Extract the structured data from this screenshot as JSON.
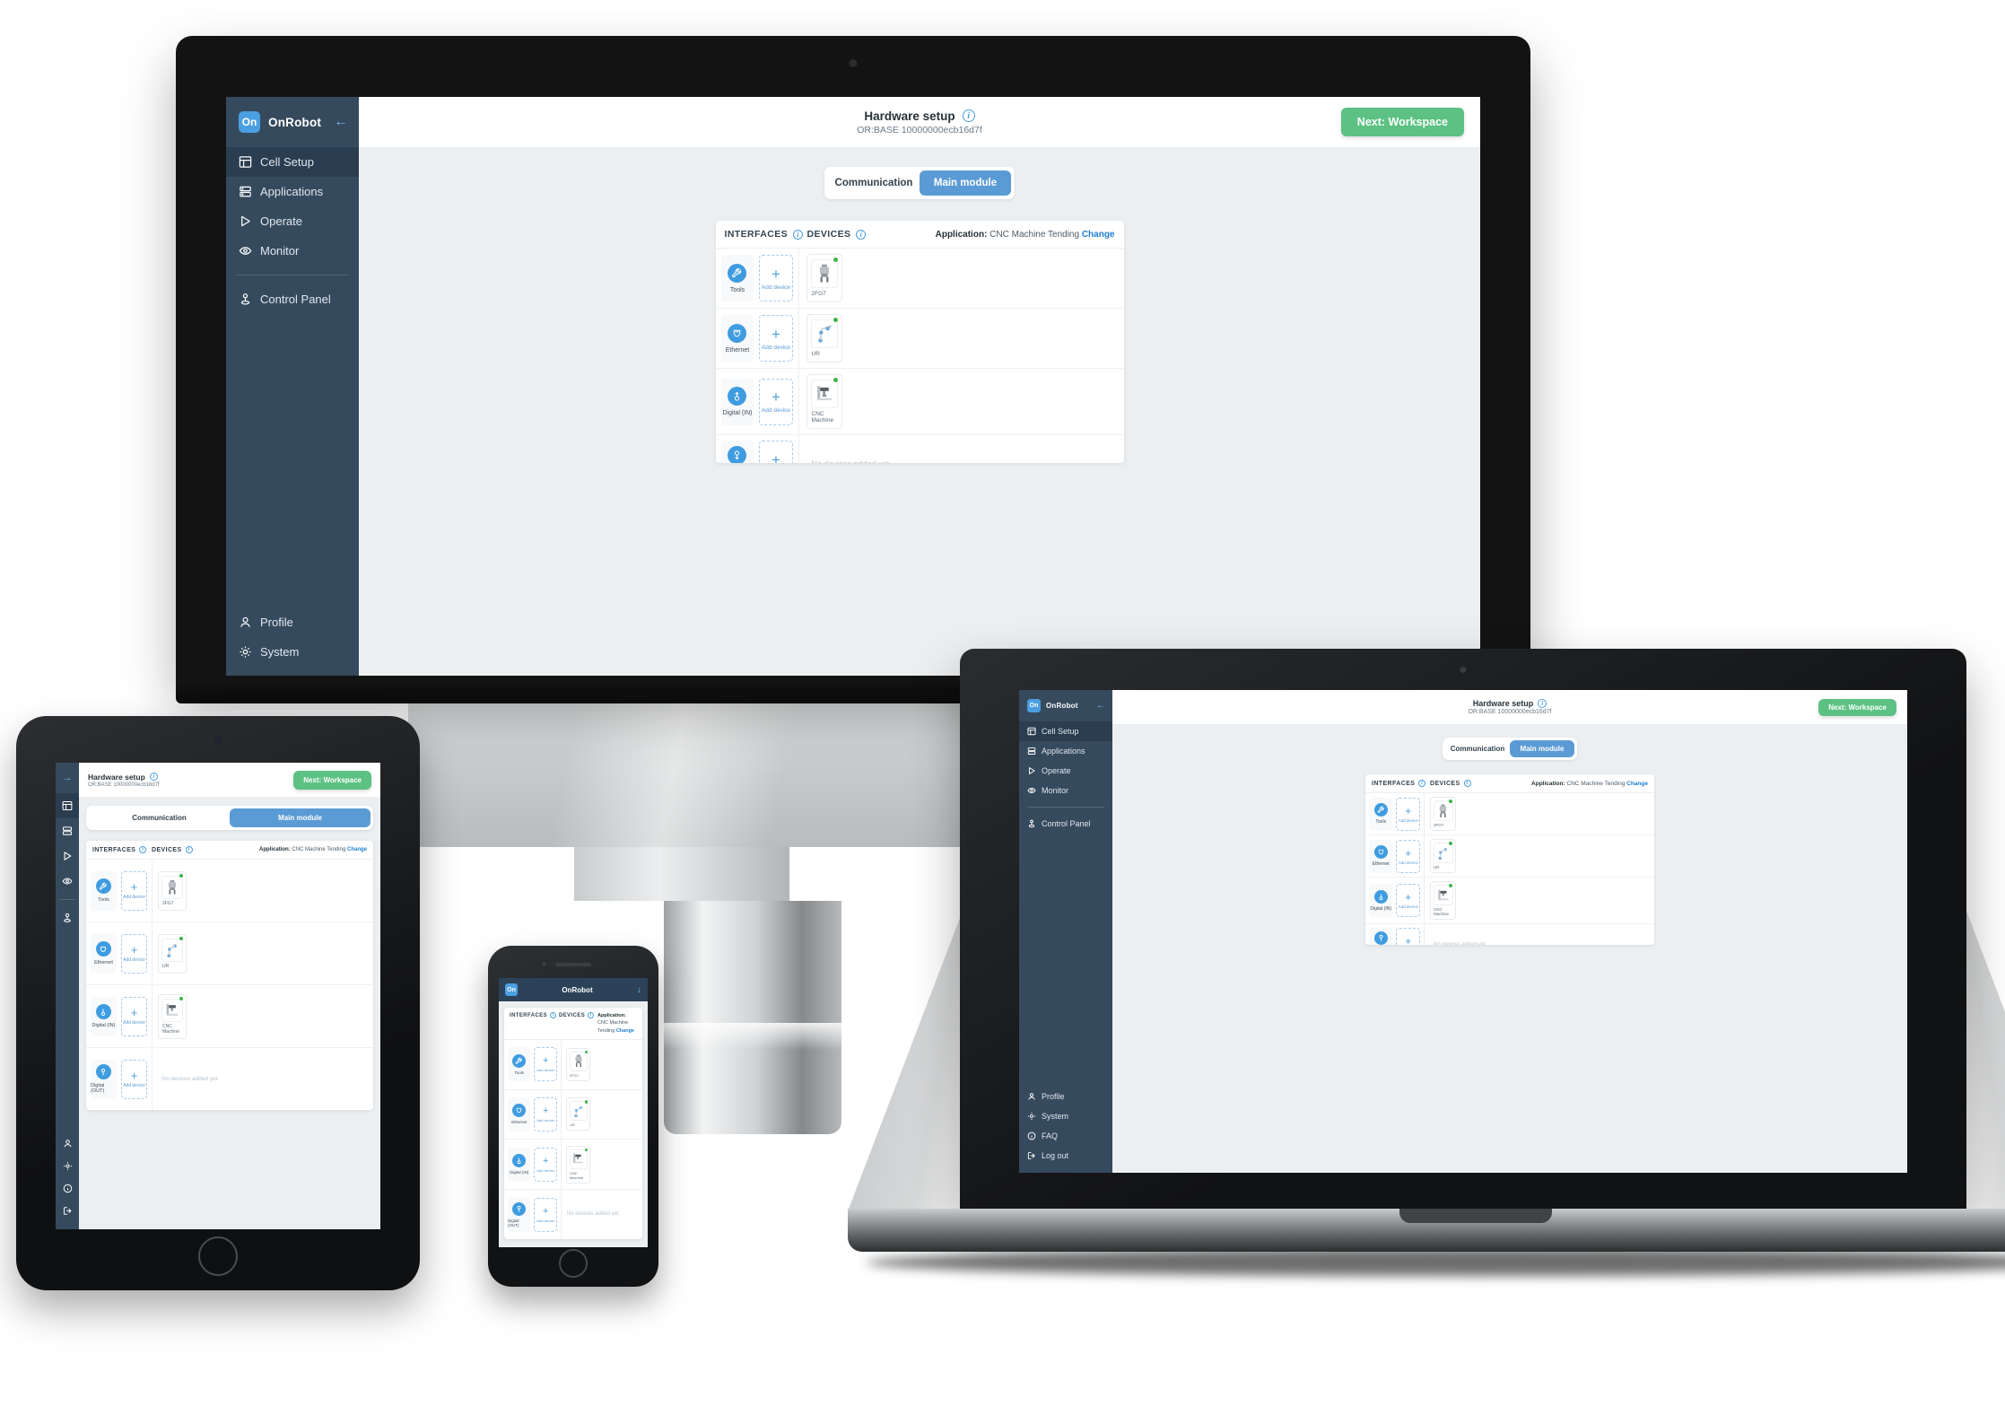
{
  "app": {
    "brand": "OnRobot",
    "logo_text": "On",
    "back_icon": "arrow-left-icon",
    "collapse_icon": "arrow-right-icon",
    "sidebar": {
      "primary_items": [
        {
          "label": "Cell Setup",
          "icon": "layout-icon",
          "active": true
        },
        {
          "label": "Applications",
          "icon": "stack-icon",
          "active": false
        },
        {
          "label": "Operate",
          "icon": "play-icon",
          "active": false
        },
        {
          "label": "Monitor",
          "icon": "eye-icon",
          "active": false
        }
      ],
      "secondary_items": [
        {
          "label": "Control Panel",
          "icon": "joystick-icon",
          "active": false
        }
      ],
      "footer_items": [
        {
          "label": "Profile",
          "icon": "user-icon"
        },
        {
          "label": "System",
          "icon": "gear-icon"
        },
        {
          "label": "FAQ",
          "icon": "info-icon"
        },
        {
          "label": "Log out",
          "icon": "logout-icon"
        }
      ]
    },
    "topbar": {
      "title": "Hardware setup",
      "subtitle": "OR:BASE 10000000ecb16d7f",
      "info_icon": "info-icon",
      "next_button": "Next: Workspace"
    },
    "tabs": [
      {
        "label": "Communication",
        "active": false
      },
      {
        "label": "Main module",
        "active": true
      }
    ],
    "panel": {
      "interfaces_header": "INTERFACES",
      "devices_header": "DEVICES",
      "interfaces_info_icon": "info-icon",
      "devices_info_icon": "info-icon",
      "application_label": "Application:",
      "application_value": "CNC Machine Tending",
      "change_link": "Change",
      "add_device_label": "Add device",
      "empty_text": "No devices added yet.",
      "rows": [
        {
          "interface": "Tools",
          "icon": "wrench-icon",
          "device": "2FG7",
          "device_icon": "gripper-icon",
          "status": "online"
        },
        {
          "interface": "Ethernet",
          "icon": "ethernet-port-icon",
          "device": "UR",
          "device_icon": "robot-arm-icon",
          "status": "online"
        },
        {
          "interface": "Digital (IN)",
          "icon": "digital-in-icon",
          "device": "CNC Machine",
          "device_icon": "cnc-machine-icon",
          "status": "online"
        },
        {
          "interface": "Digital (OUT)",
          "icon": "digital-out-icon",
          "device": null,
          "device_icon": null,
          "status": null
        }
      ]
    },
    "phone_header": {
      "title": "OnRobot",
      "logo_text": "On",
      "caret_icon": "chevron-down-icon"
    }
  },
  "colors": {
    "sidebar_bg": "#364a5e",
    "sidebar_active": "#2b3d50",
    "accent_blue": "#4a9fe0",
    "tab_active": "#5b9bd5",
    "next_green": "#5cc183",
    "status_green": "#3cb54a",
    "page_bg": "#eceff1",
    "link_blue": "#1f7fd0"
  }
}
